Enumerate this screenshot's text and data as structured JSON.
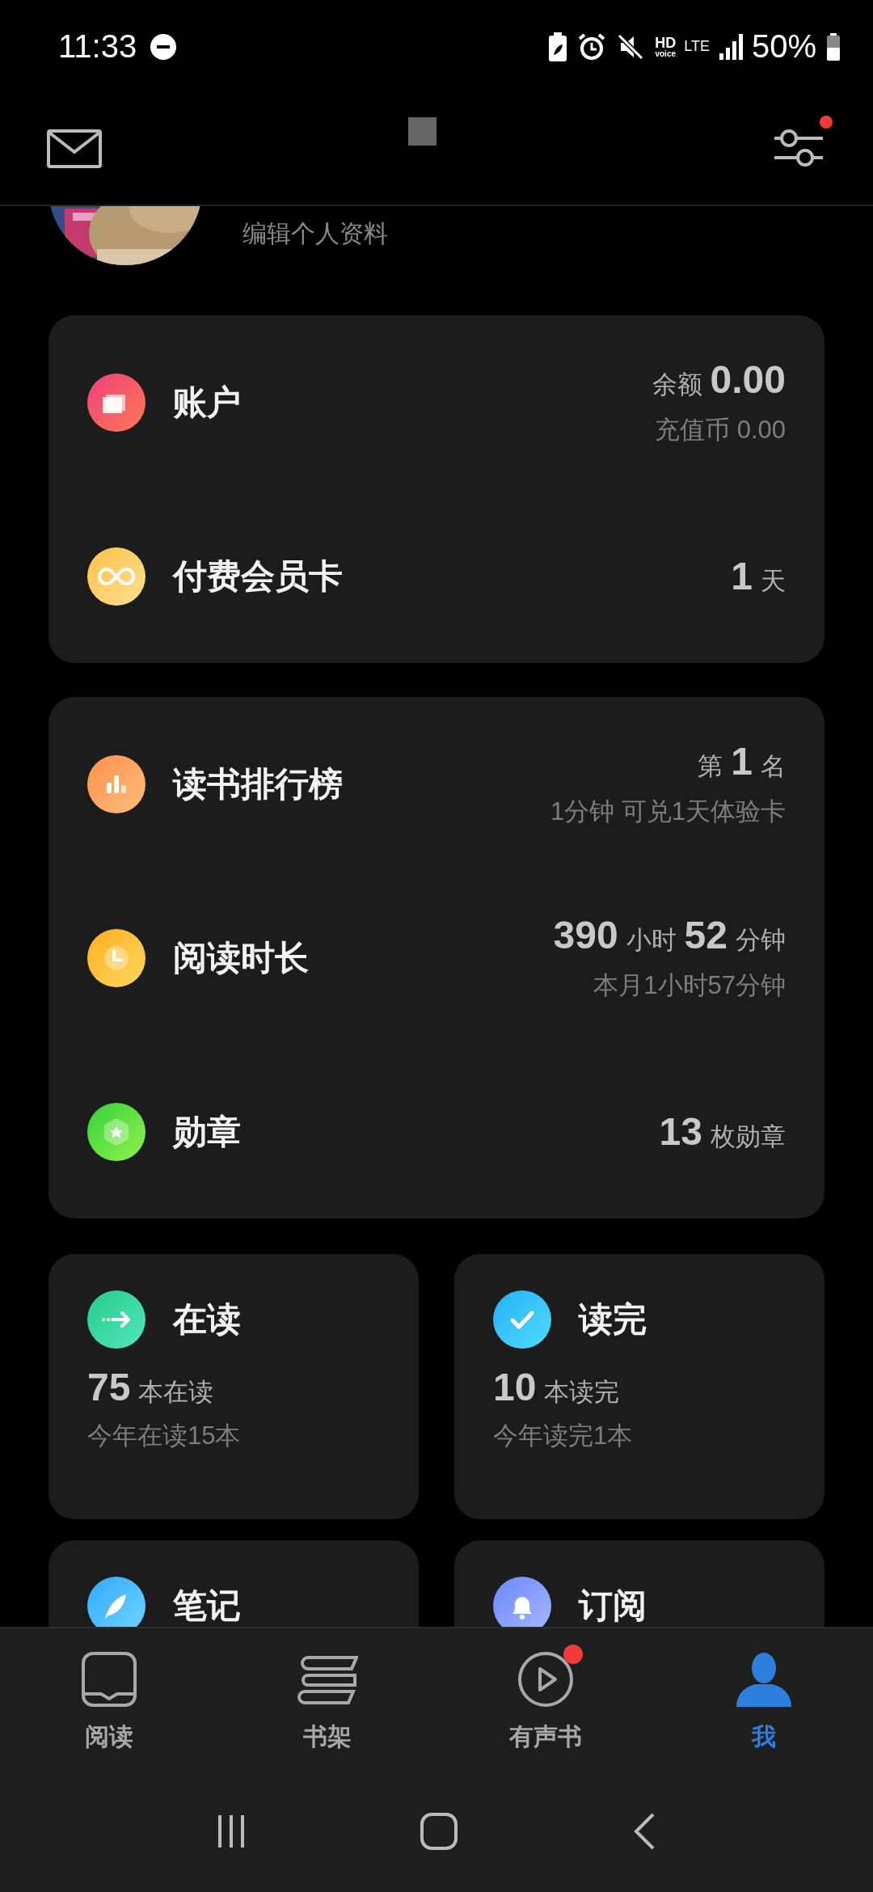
{
  "status_bar": {
    "time": "11:33",
    "network": [
      "HD",
      "voice",
      "LTE"
    ],
    "battery": "50%"
  },
  "header": {
    "settings_badge": true
  },
  "profile": {
    "subtitle": "编辑个人资料"
  },
  "account_card": {
    "rows": [
      {
        "kind": "account",
        "title": "账户",
        "value": [
          {
            "text": "余额",
            "kind": "unit"
          },
          {
            "text": "0.00",
            "kind": "number"
          }
        ],
        "note": "充值币 0.00"
      },
      {
        "kind": "membership",
        "title": "付费会员卡",
        "value": [
          {
            "text": "1",
            "kind": "number"
          },
          {
            "text": "天",
            "kind": "unit"
          }
        ]
      }
    ]
  },
  "stats_card": {
    "rows": [
      {
        "kind": "ranking",
        "title": "读书排行榜",
        "value": [
          {
            "text": "第",
            "kind": "unit"
          },
          {
            "text": "1",
            "kind": "number"
          },
          {
            "text": "名",
            "kind": "unit"
          }
        ],
        "note": "1分钟 可兑1天体验卡"
      },
      {
        "kind": "duration",
        "title": "阅读时长",
        "value": [
          {
            "text": "390",
            "kind": "number"
          },
          {
            "text": "小时",
            "kind": "unit"
          },
          {
            "text": "52",
            "kind": "number"
          },
          {
            "text": "分钟",
            "kind": "unit"
          }
        ],
        "note": "本月1小时57分钟"
      },
      {
        "kind": "badges",
        "title": "勋章",
        "value": [
          {
            "text": "13",
            "kind": "number"
          },
          {
            "text": "枚勋章",
            "kind": "unit"
          }
        ]
      }
    ]
  },
  "shelf_cards": [
    {
      "kind": "reading",
      "title": "在读",
      "count": "75",
      "unit": "本在读",
      "note": "今年在读15本"
    },
    {
      "kind": "finished",
      "title": "读完",
      "count": "10",
      "unit": "本读完",
      "note": "今年读完1本"
    },
    {
      "kind": "notes",
      "title": "笔记"
    },
    {
      "kind": "subscription",
      "title": "订阅"
    }
  ],
  "tabs": [
    {
      "kind": "read",
      "label": "阅读",
      "selected": false,
      "badge": false
    },
    {
      "kind": "shelf",
      "label": "书架",
      "selected": false,
      "badge": false
    },
    {
      "kind": "audio",
      "label": "有声书",
      "selected": false,
      "badge": true
    },
    {
      "kind": "me",
      "label": "我",
      "selected": true,
      "badge": false
    }
  ]
}
